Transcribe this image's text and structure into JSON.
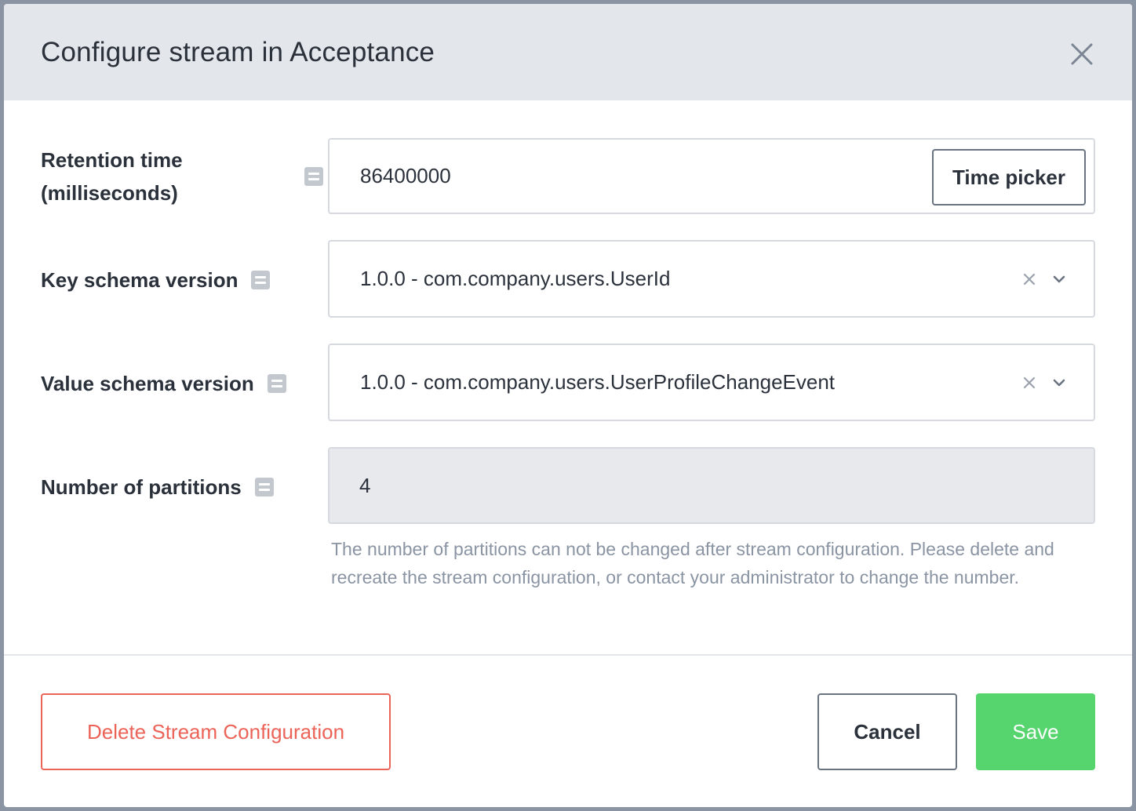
{
  "modal": {
    "title": "Configure stream in Acceptance"
  },
  "fields": {
    "retention": {
      "label_line1": "Retention time",
      "label_line2": "(milliseconds)",
      "value": "86400000",
      "button_label": "Time picker"
    },
    "key_schema": {
      "label": "Key schema version",
      "value": "1.0.0 - com.company.users.UserId"
    },
    "value_schema": {
      "label": "Value schema version",
      "value": "1.0.0 - com.company.users.UserProfileChangeEvent"
    },
    "partitions": {
      "label": "Number of partitions",
      "value": "4",
      "help_text": "The number of partitions can not be changed after stream configuration. Please delete and recreate the stream configuration, or contact your administrator to change the number."
    }
  },
  "footer": {
    "delete_label": "Delete Stream Configuration",
    "cancel_label": "Cancel",
    "save_label": "Save"
  },
  "colors": {
    "header_bg": "#e3e6ea",
    "save": "#56d46e",
    "delete": "#ec6358",
    "muted_text": "#8a94a3",
    "disabled_bg": "#e7e9ec"
  },
  "icons": {
    "close": "close-icon",
    "info": "info-icon",
    "clear": "clear-icon",
    "dropdown": "chevron-down-icon"
  }
}
